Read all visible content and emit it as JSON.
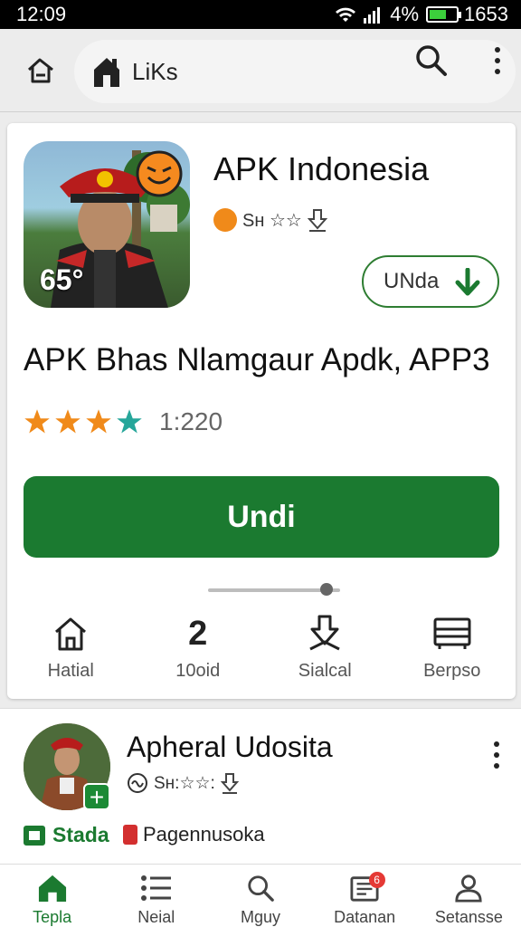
{
  "status_bar": {
    "time": "12:09",
    "battery_pct": "4%",
    "clock_right": "1653",
    "battery_level": 0.7
  },
  "top_bar": {
    "title": "LiKs"
  },
  "app": {
    "name": "APK Indonesia",
    "developer": "Sн ☆☆",
    "icon_badge": "65°",
    "secondary_button": "UNda",
    "headline": "APK Bhas Nlamgaur Apdk, APP3",
    "rating": 3.5,
    "rating_count": "1:220",
    "install_button": "Undi",
    "slider_value": 0.9,
    "features": [
      {
        "icon": "home-icon",
        "label": "Hatial"
      },
      {
        "value": "2",
        "label": "10oid"
      },
      {
        "icon": "download-icon",
        "label": "Sialcal"
      },
      {
        "icon": "bed-icon",
        "label": "Berpso"
      }
    ]
  },
  "second_app": {
    "name": "Apheral Udosita",
    "meta": "Sн:☆☆:",
    "tag_primary": "Stada",
    "tag_secondary": "Pagennusoka"
  },
  "bottom_nav": [
    {
      "icon": "home-icon",
      "label": "Tepla",
      "active": true
    },
    {
      "icon": "list-icon",
      "label": "Neial"
    },
    {
      "icon": "search-icon",
      "label": "Mguy"
    },
    {
      "icon": "inbox-icon",
      "label": "Datanan",
      "badge": "6"
    },
    {
      "icon": "person-icon",
      "label": "Setansse"
    }
  ],
  "colors": {
    "accent": "#1b7a30",
    "star": "#f08a1a",
    "star_half": "#26a69a"
  }
}
